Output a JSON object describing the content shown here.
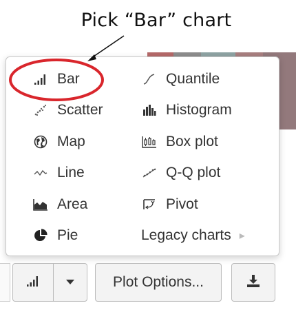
{
  "annotation": {
    "callout": "Pick “Bar” chart",
    "highlight_color": "#d9262c"
  },
  "background": {
    "segments": [
      "#b56a6a",
      "#8d8d8d",
      "#8ea3a3",
      "#a87f80",
      "#93797c"
    ]
  },
  "chart_menu": {
    "left_column": [
      {
        "label": "Bar",
        "icon": "bar-chart-icon"
      },
      {
        "label": "Scatter",
        "icon": "scatter-icon"
      },
      {
        "label": "Map",
        "icon": "globe-icon"
      },
      {
        "label": "Line",
        "icon": "line-chart-icon"
      },
      {
        "label": "Area",
        "icon": "area-chart-icon"
      },
      {
        "label": "Pie",
        "icon": "pie-chart-icon"
      }
    ],
    "right_column": [
      {
        "label": "Quantile",
        "icon": "quantile-icon"
      },
      {
        "label": "Histogram",
        "icon": "histogram-icon"
      },
      {
        "label": "Box plot",
        "icon": "box-plot-icon"
      },
      {
        "label": "Q-Q plot",
        "icon": "qq-plot-icon"
      },
      {
        "label": "Pivot",
        "icon": "pivot-icon"
      },
      {
        "label": "Legacy charts",
        "icon": "chevron-right-icon"
      }
    ]
  },
  "toolbar": {
    "chart_type_icon": "bar-chart-icon",
    "dropdown_icon": "caret-down-icon",
    "plot_options_label": "Plot Options...",
    "download_icon": "download-icon"
  }
}
